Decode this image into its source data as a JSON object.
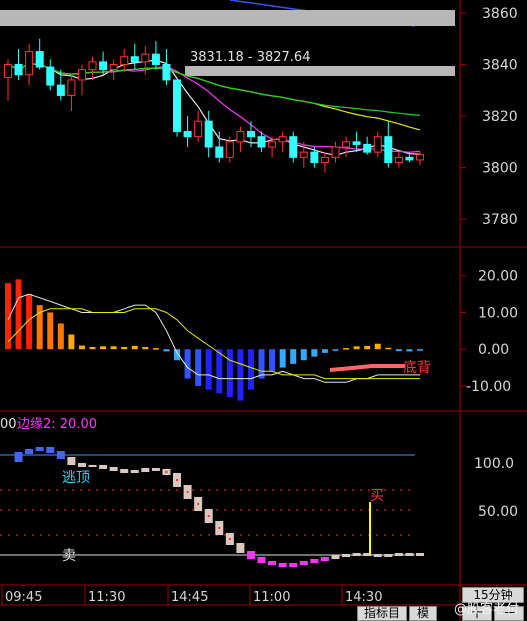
{
  "price_panel": {
    "y_ticks": [
      "3860",
      "3840",
      "3820",
      "3800",
      "3780"
    ],
    "range_label": "3831.18 - 3827.64"
  },
  "macd_panel": {
    "y_ticks": [
      "20.00",
      "10.00",
      "0.00",
      "-10.00"
    ],
    "divergence_label": "底背"
  },
  "indicator_panel": {
    "param_prefix": "00",
    "param_label": "边缘2: 20.00",
    "y_ticks": [
      "100.0",
      "50.00"
    ],
    "escape_label": "逃顶",
    "buy_label": "买",
    "sell_label": "卖"
  },
  "time_axis": [
    "09:45",
    "11:30",
    "14:45",
    "11:00",
    "14:30"
  ],
  "period_label": "15分钟",
  "buttons": {
    "indicators": "指标目",
    "template": "模",
    "plus": "十",
    "minus": "一"
  },
  "watermark": "@股客老付",
  "colors": {
    "up": "#ff3333",
    "down": "#33ffff",
    "panel_border": "#a00000",
    "ma_white": "#e8e8e8",
    "ma_yellow": "#e8e800",
    "ma_green": "#22cc22",
    "ma_magenta": "#ff33ff",
    "trend_blue": "#3355ff"
  },
  "chart_data": {
    "type": "candlestick",
    "price_ylim": [
      3770,
      3865
    ],
    "candles_note": "",
    "candles": [
      {
        "o": 3835,
        "h": 3842,
        "l": 3826,
        "c": 3840
      },
      {
        "o": 3840,
        "h": 3846,
        "l": 3834,
        "c": 3836
      },
      {
        "o": 3836,
        "h": 3848,
        "l": 3832,
        "c": 3845
      },
      {
        "o": 3845,
        "h": 3850,
        "l": 3838,
        "c": 3839
      },
      {
        "o": 3839,
        "h": 3842,
        "l": 3830,
        "c": 3832
      },
      {
        "o": 3832,
        "h": 3838,
        "l": 3826,
        "c": 3828
      },
      {
        "o": 3828,
        "h": 3836,
        "l": 3822,
        "c": 3834
      },
      {
        "o": 3834,
        "h": 3840,
        "l": 3828,
        "c": 3838
      },
      {
        "o": 3838,
        "h": 3843,
        "l": 3834,
        "c": 3841
      },
      {
        "o": 3841,
        "h": 3845,
        "l": 3836,
        "c": 3838
      },
      {
        "o": 3838,
        "h": 3842,
        "l": 3834,
        "c": 3840
      },
      {
        "o": 3840,
        "h": 3846,
        "l": 3837,
        "c": 3843
      },
      {
        "o": 3843,
        "h": 3848,
        "l": 3838,
        "c": 3841
      },
      {
        "o": 3841,
        "h": 3847,
        "l": 3836,
        "c": 3844
      },
      {
        "o": 3844,
        "h": 3849,
        "l": 3838,
        "c": 3840
      },
      {
        "o": 3840,
        "h": 3846,
        "l": 3832,
        "c": 3834
      },
      {
        "o": 3834,
        "h": 3832,
        "l": 3812,
        "c": 3814
      },
      {
        "o": 3814,
        "h": 3820,
        "l": 3808,
        "c": 3812
      },
      {
        "o": 3812,
        "h": 3822,
        "l": 3810,
        "c": 3818
      },
      {
        "o": 3818,
        "h": 3822,
        "l": 3804,
        "c": 3808
      },
      {
        "o": 3808,
        "h": 3814,
        "l": 3802,
        "c": 3804
      },
      {
        "o": 3804,
        "h": 3812,
        "l": 3802,
        "c": 3810
      },
      {
        "o": 3810,
        "h": 3816,
        "l": 3806,
        "c": 3814
      },
      {
        "o": 3814,
        "h": 3818,
        "l": 3808,
        "c": 3812
      },
      {
        "o": 3812,
        "h": 3814,
        "l": 3806,
        "c": 3808
      },
      {
        "o": 3808,
        "h": 3812,
        "l": 3804,
        "c": 3810
      },
      {
        "o": 3810,
        "h": 3814,
        "l": 3806,
        "c": 3812
      },
      {
        "o": 3812,
        "h": 3814,
        "l": 3802,
        "c": 3804
      },
      {
        "o": 3804,
        "h": 3810,
        "l": 3800,
        "c": 3806
      },
      {
        "o": 3806,
        "h": 3808,
        "l": 3800,
        "c": 3802
      },
      {
        "o": 3802,
        "h": 3806,
        "l": 3798,
        "c": 3804
      },
      {
        "o": 3804,
        "h": 3810,
        "l": 3802,
        "c": 3808
      },
      {
        "o": 3808,
        "h": 3812,
        "l": 3804,
        "c": 3810
      },
      {
        "o": 3810,
        "h": 3814,
        "l": 3806,
        "c": 3809
      },
      {
        "o": 3809,
        "h": 3812,
        "l": 3805,
        "c": 3806
      },
      {
        "o": 3806,
        "h": 3814,
        "l": 3804,
        "c": 3812
      },
      {
        "o": 3812,
        "h": 3818,
        "l": 3800,
        "c": 3802
      },
      {
        "o": 3802,
        "h": 3806,
        "l": 3800,
        "c": 3804
      },
      {
        "o": 3804,
        "h": 3806,
        "l": 3802,
        "c": 3803
      },
      {
        "o": 3803,
        "h": 3806,
        "l": 3801,
        "c": 3805
      }
    ],
    "macd_ylim": [
      -16,
      27
    ],
    "macd_hist": [
      18,
      19,
      15,
      12,
      10,
      7,
      4,
      1,
      0.6,
      0.8,
      0.8,
      0.6,
      0.9,
      0.6,
      0.3,
      -0.6,
      -3,
      -8,
      -10,
      -11,
      -12,
      -13,
      -14,
      -11,
      -8,
      -6,
      -5,
      -4,
      -3,
      -2,
      -1,
      -0.3,
      0.3,
      0.8,
      0.9,
      1.5,
      0.4,
      -0.5,
      -0.6,
      -0.4
    ],
    "macd_dif": [
      8,
      14,
      15,
      14,
      13,
      12,
      11,
      10,
      10,
      10,
      10,
      11,
      12,
      12,
      10,
      5,
      -1,
      -5,
      -7,
      -7,
      -8,
      -8,
      -8,
      -8,
      -7,
      -7,
      -6,
      -7,
      -8,
      -8,
      -9,
      -9,
      -9,
      -8,
      -8,
      -7,
      -7,
      -7,
      -7,
      -7
    ],
    "macd_dea": [
      2,
      5,
      8,
      10,
      11,
      11,
      11,
      11,
      10,
      10,
      10,
      10,
      11,
      11,
      11,
      10,
      8,
      5,
      3,
      1,
      -1,
      -3,
      -4,
      -5,
      -6,
      -6,
      -7,
      -7,
      -7,
      -7,
      -8,
      -8,
      -8,
      -8,
      -8,
      -8,
      -8,
      -8,
      -8,
      -8
    ],
    "osc_ylim": [
      -20,
      140
    ],
    "osc_values": [
      95,
      103,
      106,
      108,
      104,
      98,
      92,
      90,
      90,
      88,
      86,
      84,
      85,
      87,
      86,
      82,
      70,
      58,
      46,
      34,
      22,
      12,
      4,
      -2,
      -6,
      -8,
      -10,
      -8,
      -6,
      -4,
      -2,
      0,
      1,
      2,
      1,
      0,
      1,
      2,
      1,
      2
    ],
    "osc_thresholds": [
      100,
      50
    ]
  }
}
